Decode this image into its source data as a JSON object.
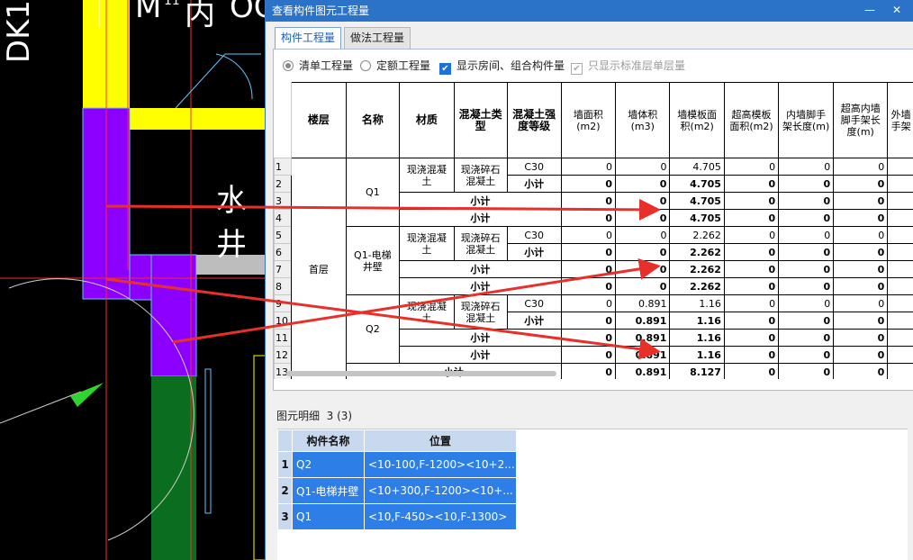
{
  "cad": {
    "labels": [
      "DK1",
      "M",
      "内",
      "OC",
      "11",
      "水井"
    ]
  },
  "window": {
    "title": "查看构件图元工程量",
    "minimize_icon": "minimize-icon",
    "close_icon": "close-icon"
  },
  "tabs": [
    {
      "label": "构件工程量",
      "active": true
    },
    {
      "label": "做法工程量",
      "active": false
    }
  ],
  "options": {
    "qingdan": "清单工程量",
    "dinge": "定额工程量",
    "show_rooms": "显示房间、组合构件量",
    "only_standard": "只显示标准层单层量"
  },
  "table": {
    "headers": [
      "楼层",
      "名称",
      "材质",
      "混凝土类型",
      "混凝土强度等级",
      "墙面积(m2)",
      "墙体积(m3)",
      "墙模板面积(m2)",
      "超高模板面积(m2)",
      "内墙脚手架长度(m)",
      "超高内墙脚手架长度(m)",
      "外墙手架"
    ],
    "floor": "首层",
    "groups": [
      {
        "name": "Q1",
        "material": "现浇混凝土",
        "concrete_type": "现浇碎石混凝土"
      },
      {
        "name": "Q1-电梯井壁",
        "material": "现浇混凝土",
        "concrete_type": "现浇碎石混凝土"
      },
      {
        "name": "Q2",
        "material": "现浇混凝土",
        "concrete_type": "现浇碎石混凝土"
      }
    ],
    "grade": "C30",
    "subtotal": "小计",
    "rows": [
      [
        "1",
        "0",
        "0",
        "4.705",
        "0",
        "0",
        "0"
      ],
      [
        "2",
        "0",
        "0",
        "4.705",
        "0",
        "0",
        "0"
      ],
      [
        "3",
        "0",
        "0",
        "4.705",
        "0",
        "0",
        "0"
      ],
      [
        "4",
        "0",
        "0",
        "4.705",
        "0",
        "0",
        "0"
      ],
      [
        "5",
        "0",
        "0",
        "2.262",
        "0",
        "0",
        "0"
      ],
      [
        "6",
        "0",
        "0",
        "2.262",
        "0",
        "0",
        "0"
      ],
      [
        "7",
        "0",
        "0",
        "2.262",
        "0",
        "0",
        "0"
      ],
      [
        "8",
        "0",
        "0",
        "2.262",
        "0",
        "0",
        "0"
      ],
      [
        "9",
        "0",
        "0.891",
        "1.16",
        "0",
        "0",
        "0"
      ],
      [
        "10",
        "0",
        "0.891",
        "1.16",
        "0",
        "0",
        "0"
      ],
      [
        "11",
        "0",
        "0.891",
        "1.16",
        "0",
        "0",
        "0"
      ],
      [
        "12",
        "0",
        "0.891",
        "1.16",
        "0",
        "0",
        "0"
      ],
      [
        "13",
        "0",
        "0.891",
        "8.127",
        "0",
        "0",
        "0"
      ]
    ]
  },
  "detail": {
    "label": "图元明细",
    "count": "3 (3)",
    "headers": [
      "构件名称",
      "位置"
    ],
    "rows": [
      {
        "no": "1",
        "name": "Q2",
        "pos": "<10-100,F-1200><10+2..."
      },
      {
        "no": "2",
        "name": "Q1-电梯井壁",
        "pos": "<10+300,F-1200><10+..."
      },
      {
        "no": "3",
        "name": "Q1",
        "pos": "<10,F-450><10,F-1300>"
      }
    ]
  },
  "colors": {
    "title_bar": "#2b72c9",
    "wall_yellow": "#ffff00",
    "wall_purple": "#8b00ff",
    "wall_green": "#0a6e1e",
    "arrow_red": "#e8302a",
    "selection_blue": "#2d7ee6"
  }
}
